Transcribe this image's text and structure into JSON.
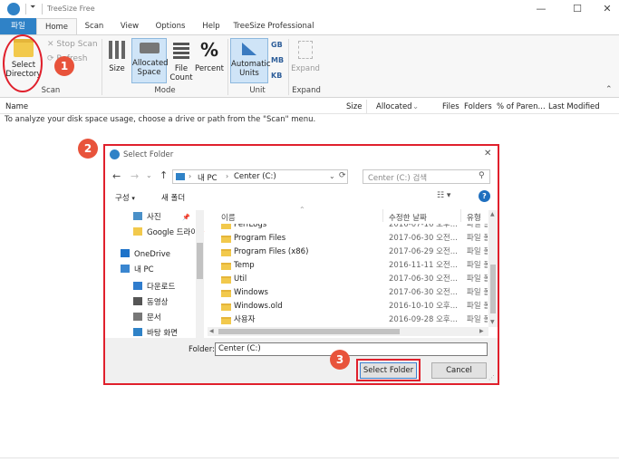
{
  "window": {
    "title": "TreeSize Free"
  },
  "tabs": {
    "file": "파일",
    "home": "Home",
    "scan": "Scan",
    "view": "View",
    "options": "Options",
    "help": "Help",
    "pro": "TreeSize Professional"
  },
  "ribbon": {
    "select_directory": "Select Directory",
    "stop_scan": "Stop Scan",
    "refresh": "Refresh",
    "scan_group": "Scan",
    "size": "Size",
    "allocated_space": "Allocated Space",
    "file_count": "File Count",
    "percent": "Percent",
    "percent_symbol": "%",
    "mode_group": "Mode",
    "automatic_units": "Automatic Units",
    "gb": "GB",
    "mb": "MB",
    "kb": "KB",
    "unit_group": "Unit",
    "expand_button": "Expand",
    "expand_group": "Expand"
  },
  "columns": {
    "name": "Name",
    "size": "Size",
    "allocated": "Allocated",
    "files": "Files",
    "folders": "Folders",
    "percent": "% of Paren...",
    "last_modified": "Last Modified"
  },
  "hint": "To analyze your disk space usage, choose a drive or path from the \"Scan\" menu.",
  "dialog": {
    "title": "Select Folder",
    "path": [
      "내 PC",
      "Center (C:)"
    ],
    "search_placeholder": "Center (C:) 검색",
    "organize": "구성",
    "new_folder": "새 폴더",
    "nav_items": [
      {
        "label": "사진",
        "icon": "picture-icon"
      },
      {
        "label": "Google 드라이",
        "icon": "folder-icon"
      },
      {
        "label": "OneDrive",
        "icon": "cloud-icon"
      },
      {
        "label": "내 PC",
        "icon": "computer-icon"
      },
      {
        "label": "다운로드",
        "icon": "download-icon"
      },
      {
        "label": "동영상",
        "icon": "video-icon"
      },
      {
        "label": "문서",
        "icon": "document-icon"
      },
      {
        "label": "바탕 화면",
        "icon": "desktop-icon"
      }
    ],
    "col_name": "이름",
    "col_modified": "수정한 날짜",
    "col_type": "유형",
    "files": [
      {
        "name": "PerfLogs",
        "date": "2016-07-16 오후...",
        "type": "파일 폴"
      },
      {
        "name": "Program Files",
        "date": "2017-06-30 오전...",
        "type": "파일 폴"
      },
      {
        "name": "Program Files (x86)",
        "date": "2017-06-29 오전...",
        "type": "파일 폴"
      },
      {
        "name": "Temp",
        "date": "2016-11-11 오전...",
        "type": "파일 폴"
      },
      {
        "name": "Util",
        "date": "2017-06-30 오전...",
        "type": "파일 폴"
      },
      {
        "name": "Windows",
        "date": "2017-06-30 오전...",
        "type": "파일 폴"
      },
      {
        "name": "Windows.old",
        "date": "2016-10-10 오후...",
        "type": "파일 폴"
      },
      {
        "name": "사용자",
        "date": "2016-09-28 오후...",
        "type": "파일 폴"
      }
    ],
    "folder_label": "Folder:",
    "folder_value": "Center (C:)",
    "select_button": "Select Folder",
    "cancel_button": "Cancel"
  },
  "annotations": {
    "step1": "1",
    "step2": "2",
    "step3": "3"
  },
  "colors": {
    "accent": "#2f82c7",
    "highlight": "#e0202c",
    "badge": "#e8533b"
  }
}
